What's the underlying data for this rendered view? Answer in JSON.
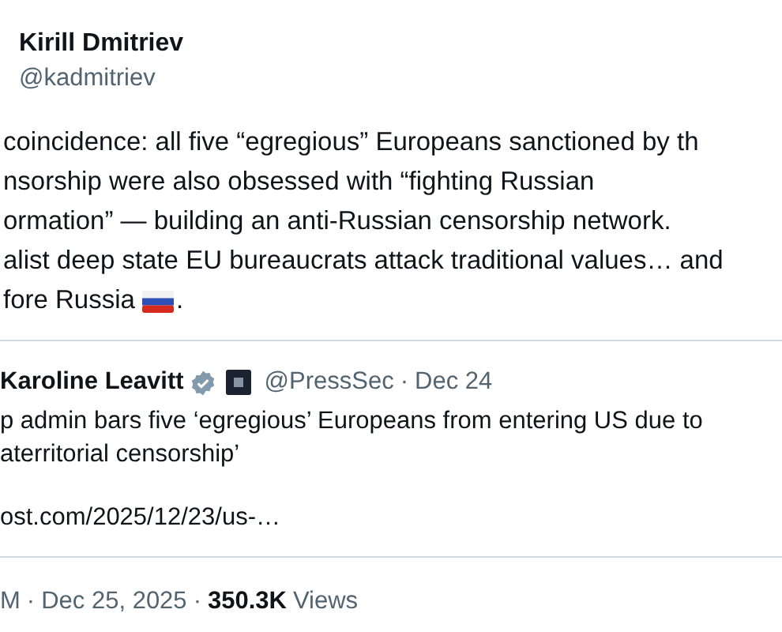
{
  "post": {
    "author_name": "Kirill Dmitriev",
    "author_handle": "@kadmitriev",
    "body_lines": [
      "coincidence: all five “egregious” Europeans sanctioned by th",
      "nsorship were also obsessed with “fighting Russian",
      "ormation” — building an anti-Russian censorship network.",
      "alist deep state EU bureaucrats attack traditional values… and",
      "fore Russia"
    ],
    "body_end": ".",
    "quote": {
      "author_name": "Karoline Leavitt",
      "verified": true,
      "author_handle": "@PressSec",
      "separator": "·",
      "date": "Dec 24",
      "text_lines": [
        "p admin bars five ‘egregious’ Europeans from entering US due to",
        "aterritorial censorship’"
      ],
      "link": "ost.com/2025/12/23/us-…"
    },
    "meta": {
      "time": "M",
      "separator_1": "·",
      "date": "Dec 25, 2025",
      "separator_2": "·",
      "views_count": "350.3K",
      "views_label": "Views"
    }
  }
}
